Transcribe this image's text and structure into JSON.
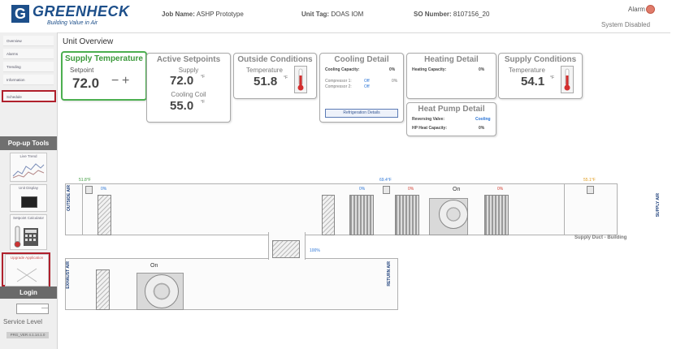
{
  "header": {
    "logo_text": "GREENHECK",
    "logo_tagline": "Building Value in Air",
    "job_name_label": "Job Name:",
    "job_name": "ASHP Prototype",
    "unit_tag_label": "Unit Tag:",
    "unit_tag": "DOAS IOM",
    "so_number_label": "SO Number:",
    "so_number": "8107156_20",
    "alarm_label": "Alarm",
    "system_status": "System Disabled"
  },
  "sidebar": {
    "items": [
      {
        "label": "Overview"
      },
      {
        "label": "Alarms"
      },
      {
        "label": "Trending"
      },
      {
        "label": "Information"
      },
      {
        "label": "Schedule"
      }
    ],
    "popup_tools_label": "Pop-up Tools",
    "tools": [
      {
        "label": "Live Trend"
      },
      {
        "label": "Unit Display"
      },
      {
        "label": "Setpoint Calculator"
      },
      {
        "label": "Upgrade Application"
      }
    ],
    "login_label": "Login",
    "login_field_value": "----",
    "service_level": "Service Level",
    "version": "PRG_VER 4.1.14.1.0"
  },
  "overview_title": "Unit Overview",
  "cards": {
    "supply_temperature": {
      "title": "Supply Temperature",
      "setpoint_label": "Setpoint",
      "value": "72.0",
      "minus": "−",
      "plus": "+"
    },
    "active_setpoints": {
      "title": "Active Setpoints",
      "supply_label": "Supply",
      "supply_value": "72.0",
      "cooling_coil_label": "Cooling Coil",
      "cooling_coil_value": "55.0",
      "unit": "°F"
    },
    "outside_conditions": {
      "title": "Outside Conditions",
      "temperature_label": "Temperature",
      "value": "51.8",
      "unit": "°F"
    },
    "cooling_detail": {
      "title": "Cooling Detail",
      "cooling_capacity_label": "Cooling Capacity:",
      "cooling_capacity": "0%",
      "compressor1_label": "Compressor 1:",
      "compressor1_state": "Off",
      "compressor1_pct": "0%",
      "compressor2_label": "Compressor 2:",
      "compressor2_state": "Off",
      "button": "Refrigeration Details"
    },
    "heating_detail": {
      "title": "Heating Detail",
      "heating_capacity_label": "Heating Capacity:",
      "heating_capacity": "0%"
    },
    "heat_pump_detail": {
      "title": "Heat Pump Detail",
      "reversing_valve_label": "Reversing Valve:",
      "reversing_valve": "Cooling",
      "hp_heat_capacity_label": "HP Heat Capacity:",
      "hp_heat_capacity": "0%"
    },
    "supply_conditions": {
      "title": "Supply Conditions",
      "temperature_label": "Temperature",
      "value": "54.1",
      "unit": "°F"
    }
  },
  "diagram": {
    "outside_air_label": "OUTSIDE AIR",
    "exhaust_air_label": "EXHAUST AIR",
    "return_air_label": "RETURN AIR",
    "supply_air_label": "SUPPLY AIR",
    "supply_duct_label": "Supply Duct - Building",
    "oa_temp": "51.8°F",
    "oa_damper_pct": "0%",
    "mid_temp": "69.4°F",
    "filter_pct": "0%",
    "coil_pct": "0%",
    "supply_fan_state": "On",
    "heat_pct": "0%",
    "supply_temp": "55.1°F",
    "recirc_damper_pct": "100%",
    "exhaust_fan_state": "On",
    "colors": {
      "cool": "#2a74d6",
      "heat": "#d13b2e",
      "green": "#3c9a3c",
      "orange": "#e09a1a"
    }
  }
}
